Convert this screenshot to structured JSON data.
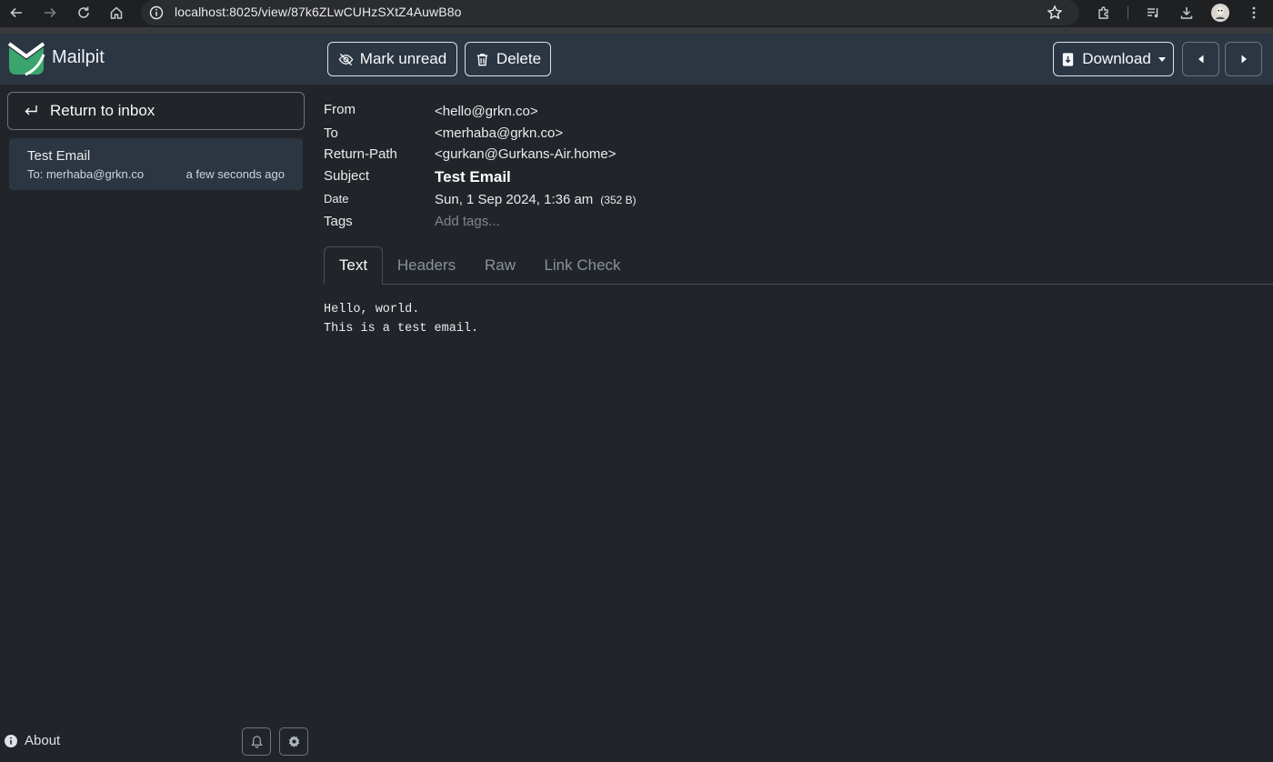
{
  "browser": {
    "url": "localhost:8025/view/87k6ZLwCUHzSXtZ4AuwB8o"
  },
  "app": {
    "name": "Mailpit"
  },
  "toolbar": {
    "mark_unread": "Mark unread",
    "delete": "Delete",
    "download": "Download"
  },
  "sidebar": {
    "return_label": "Return to inbox",
    "messages": [
      {
        "subject": "Test Email",
        "to": "To: merhaba@grkn.co",
        "time": "a few seconds ago"
      }
    ],
    "about": "About"
  },
  "message": {
    "labels": {
      "from": "From",
      "to": "To",
      "return_path": "Return-Path",
      "subject": "Subject",
      "date": "Date",
      "tags": "Tags"
    },
    "from": "<hello@grkn.co>",
    "to": "<merhaba@grkn.co>",
    "return_path": "<gurkan@Gurkans-Air.home>",
    "subject": "Test Email",
    "date": "Sun, 1 Sep 2024, 1:36 am",
    "size": "(352 B)",
    "tags_placeholder": "Add tags...",
    "body": "Hello, world.\nThis is a test email."
  },
  "tabs": [
    {
      "label": "Text",
      "active": true
    },
    {
      "label": "Headers",
      "active": false
    },
    {
      "label": "Raw",
      "active": false
    },
    {
      "label": "Link Check",
      "active": false
    }
  ],
  "colors": {
    "background": "#212529",
    "header": "#2c3542",
    "logo_green": "#3aa66d"
  }
}
